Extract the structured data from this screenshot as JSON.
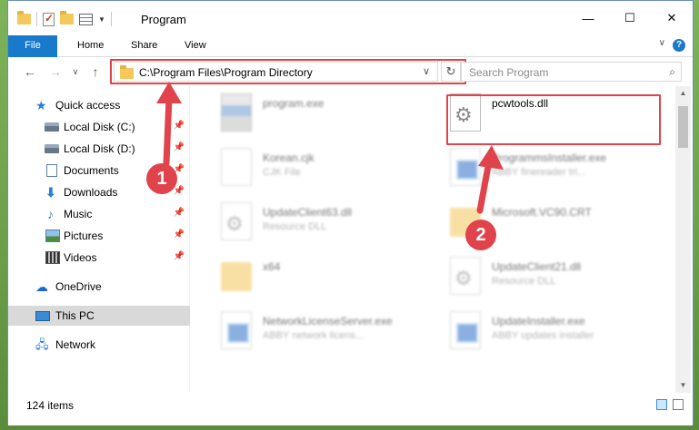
{
  "window": {
    "title": "Program",
    "controls": {
      "minimize": "—",
      "maximize": "☐",
      "close": "✕"
    }
  },
  "ribbon": {
    "tabs": [
      "File",
      "Home",
      "Share",
      "View"
    ],
    "help": "?"
  },
  "navigation": {
    "back": "←",
    "forward": "→",
    "dropdown": "∨",
    "up": "↑",
    "address": "C:\\Program Files\\Program Directory",
    "refresh": "↻",
    "search_placeholder": "Search Program"
  },
  "sidebar": {
    "items": [
      {
        "label": "Quick access",
        "icon": "star-icon",
        "pinned": false
      },
      {
        "label": "Local Disk (C:)",
        "icon": "disk-icon",
        "pinned": true
      },
      {
        "label": "Local Disk (D:)",
        "icon": "disk-icon",
        "pinned": true
      },
      {
        "label": "Documents",
        "icon": "documents-icon",
        "pinned": true
      },
      {
        "label": "Downloads",
        "icon": "download-icon",
        "pinned": true
      },
      {
        "label": "Music",
        "icon": "music-icon",
        "pinned": true
      },
      {
        "label": "Pictures",
        "icon": "pictures-icon",
        "pinned": true
      },
      {
        "label": "Videos",
        "icon": "videos-icon",
        "pinned": true
      },
      {
        "label": "OneDrive",
        "icon": "cloud-icon",
        "pinned": false
      },
      {
        "label": "This PC",
        "icon": "computer-icon",
        "pinned": false
      },
      {
        "label": "Network",
        "icon": "network-icon",
        "pinned": false
      }
    ],
    "selected": "This PC"
  },
  "files": {
    "left": [
      {
        "name": "program.exe",
        "desc": "",
        "icon": "exe-icon"
      },
      {
        "name": "Korean.cjk",
        "desc": "CJK File",
        "icon": "document-icon"
      },
      {
        "name": "UpdateClient63.dll",
        "desc": "Resource DLL",
        "icon": "dll-icon"
      },
      {
        "name": "x64",
        "desc": "",
        "icon": "folder-icon"
      },
      {
        "name": "NetworkLicenseServer.exe",
        "desc": "ABBY network licens...",
        "icon": "app-icon"
      }
    ],
    "right": [
      {
        "name": "pcwtools.dll",
        "desc": "",
        "icon": "dll-icon"
      },
      {
        "name": "ProgrammsInstaller.exe",
        "desc": "ABBY finereader tri...",
        "icon": "app-icon"
      },
      {
        "name": "Microsoft.VC90.CRT",
        "desc": "",
        "icon": "folder-icon"
      },
      {
        "name": "UpdateClient21.dll",
        "desc": "Resource DLL",
        "icon": "dll-icon"
      },
      {
        "name": "UpdateInstaller.exe",
        "desc": "ABBY updates installer",
        "icon": "app-icon"
      }
    ]
  },
  "status": {
    "count": "124 items"
  },
  "annotations": {
    "step1": "1",
    "step2": "2",
    "color": "#e0434b"
  }
}
